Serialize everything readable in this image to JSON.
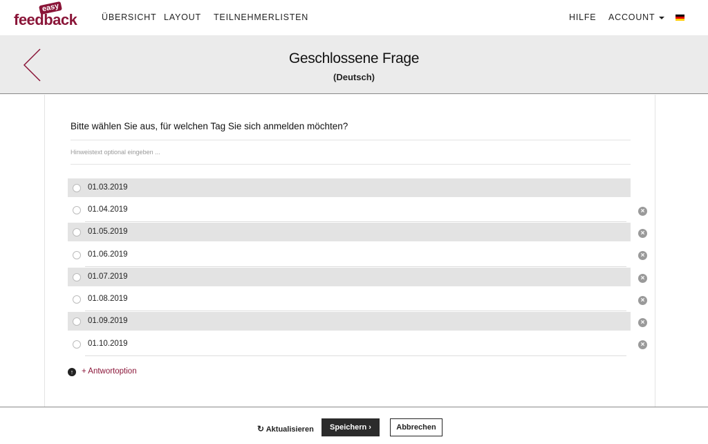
{
  "brand": {
    "small": "easy",
    "main": "feedback",
    "color": "#8a1538"
  },
  "nav": {
    "left": [
      "ÜBERSICHT",
      "LAYOUT",
      "TEILNEHMERLISTEN"
    ],
    "help": "HILFE",
    "account": "ACCOUNT",
    "language_icon": "german-flag-icon"
  },
  "header": {
    "title": "Geschlossene Frage",
    "subtitle": "(Deutsch)",
    "back_icon": "chevron-left-icon"
  },
  "question": {
    "text": "Bitte wählen Sie aus, für welchen Tag Sie sich anmelden möchten?",
    "hint_placeholder": "Hinweistext optional eingeben ..."
  },
  "options": [
    {
      "label": "01.03.2019",
      "deletable": false
    },
    {
      "label": "01.04.2019",
      "deletable": true
    },
    {
      "label": "01.05.2019",
      "deletable": true
    },
    {
      "label": "01.06.2019",
      "deletable": true
    },
    {
      "label": "01.07.2019",
      "deletable": true
    },
    {
      "label": "01.08.2019",
      "deletable": true
    },
    {
      "label": "01.09.2019",
      "deletable": true
    },
    {
      "label": "01.10.2019",
      "deletable": true
    }
  ],
  "add_option": {
    "label": "+ Antwortoption",
    "icon": "arrow-up-circle-icon"
  },
  "footer": {
    "refresh_label": "Aktualisieren",
    "save_label": "Speichern",
    "cancel_label": "Abbrechen"
  }
}
